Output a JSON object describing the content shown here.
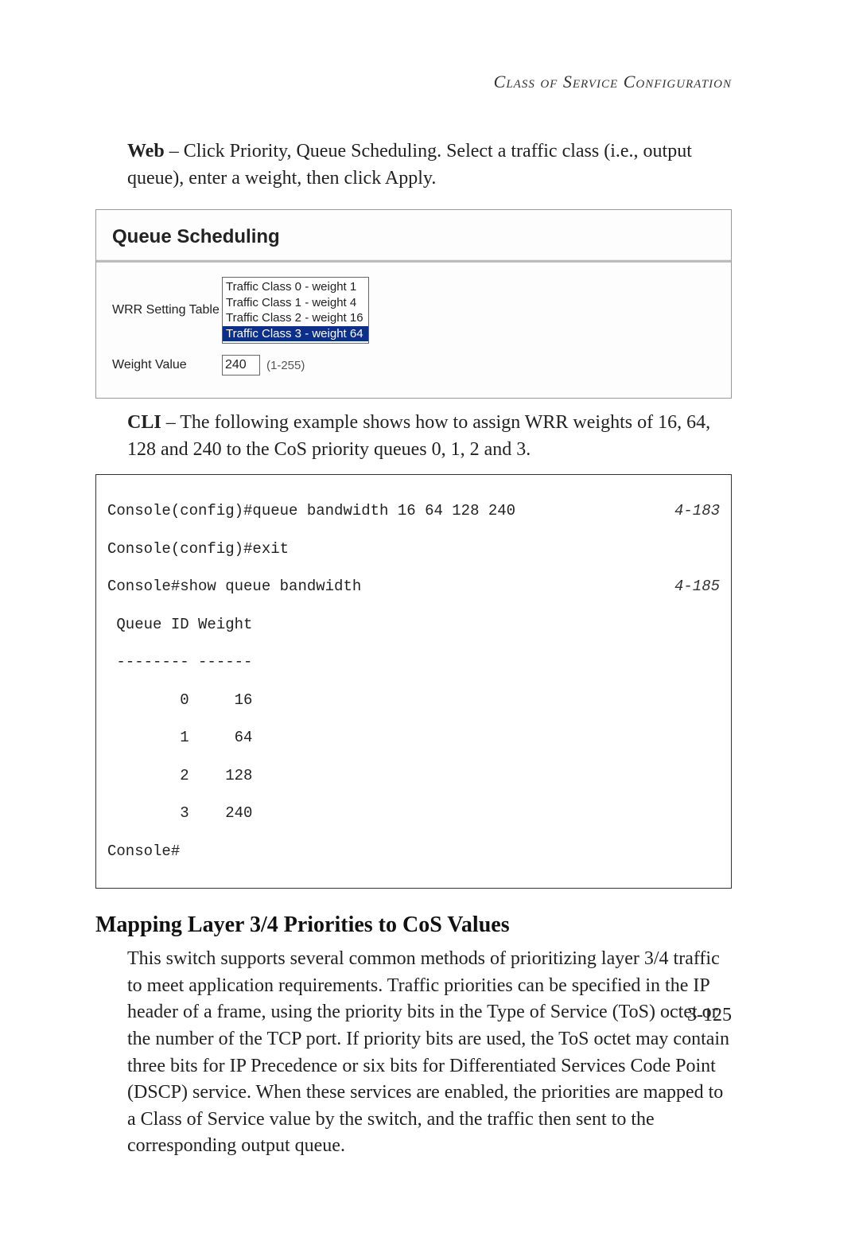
{
  "header": {
    "running": "Class of Service Configuration"
  },
  "para1": {
    "lead": "Web",
    "rest": " – Click Priority, Queue Scheduling. Select a traffic class (i.e., output queue), enter a weight, then click Apply."
  },
  "figure": {
    "title": "Queue Scheduling",
    "wrr_label": "WRR Setting Table",
    "weight_label": "Weight Value",
    "options": [
      "Traffic Class 0 - weight 1",
      "Traffic Class 1 - weight 4",
      "Traffic Class 2 - weight 16",
      "Traffic Class 3 - weight 64"
    ],
    "selected_index": 3,
    "weight_value": "240",
    "weight_hint": "(1-255)"
  },
  "para2": {
    "lead": "CLI",
    "rest": " – The following example shows how to assign WRR weights of 16, 64, 128 and 240 to the CoS priority queues 0, 1, 2 and 3."
  },
  "cli": {
    "l1_cmd": "Console(config)#queue bandwidth 16 64 128 240",
    "l1_ref": "4-183",
    "l2": "Console(config)#exit",
    "l3_cmd": "Console#show queue bandwidth",
    "l3_ref": "4-185",
    "l4": " Queue ID Weight",
    "l5": " -------- ------",
    "l6": "        0     16",
    "l7": "        1     64",
    "l8": "        2    128",
    "l9": "        3    240",
    "l10": "Console#"
  },
  "section": {
    "heading": "Mapping Layer 3/4 Priorities to CoS Values",
    "body": "This switch supports several common methods of prioritizing layer 3/4 traffic to meet application requirements. Traffic priorities can be specified in the IP header of a frame, using the priority bits in the Type of Service (ToS) octet or the number of the TCP port. If priority bits are used, the ToS octet may contain three bits for IP Precedence or six bits for Differentiated Services Code Point (DSCP) service. When these services are enabled, the priorities are mapped to a Class of Service value by the switch, and the traffic then sent to the corresponding output queue."
  },
  "page_number": "3-125"
}
